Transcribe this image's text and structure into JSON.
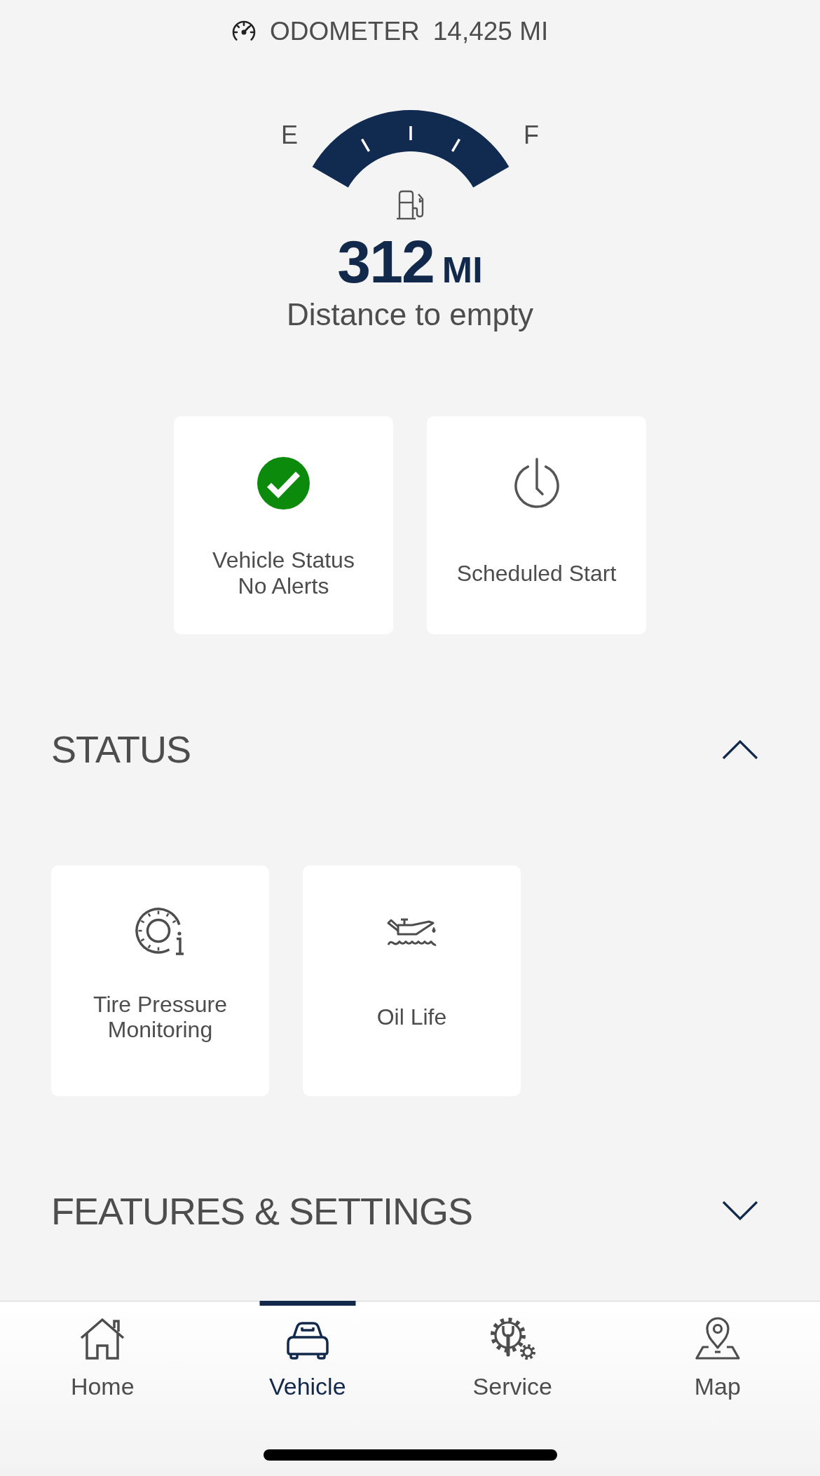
{
  "odometer": {
    "label": "ODOMETER",
    "value": "14,425 MI"
  },
  "fuel_gauge": {
    "empty_label": "E",
    "full_label": "F",
    "level": 1,
    "range": "312",
    "unit": "MI",
    "caption": "Distance to empty"
  },
  "quick_actions": [
    {
      "kind": "status",
      "title": "Vehicle Status",
      "subtitle": "No Alerts"
    },
    {
      "kind": "schedule",
      "title": "Scheduled Start"
    }
  ],
  "sections": [
    {
      "title": "STATUS",
      "expanded": true,
      "cards": [
        {
          "kind": "tire",
          "title": "Tire Pressure Monitoring"
        },
        {
          "kind": "oil",
          "title": "Oil Life"
        }
      ]
    },
    {
      "title": "FEATURES & SETTINGS",
      "expanded": false
    }
  ],
  "tab_bar": {
    "tabs": [
      {
        "kind": "home",
        "label": "Home",
        "selected": false
      },
      {
        "kind": "vehicle",
        "label": "Vehicle",
        "selected": true
      },
      {
        "kind": "service",
        "label": "Service",
        "selected": false
      },
      {
        "kind": "map",
        "label": "Map",
        "selected": false
      }
    ]
  }
}
